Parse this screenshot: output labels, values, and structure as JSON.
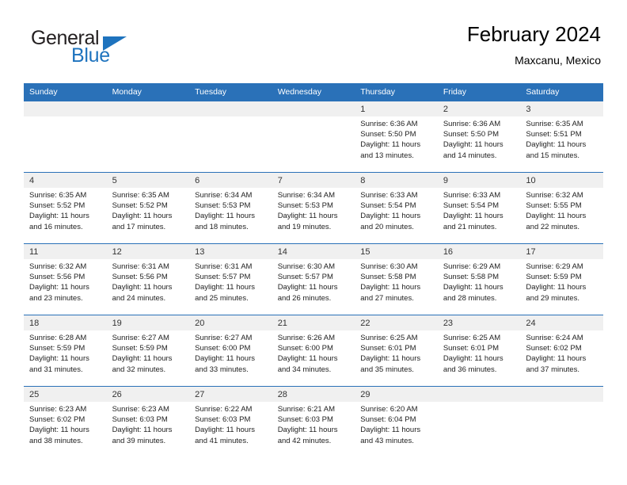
{
  "brand": {
    "name_part1": "General",
    "name_part2": "Blue",
    "logo_icon": "triangle-icon"
  },
  "header": {
    "title": "February 2024",
    "subtitle": "Maxcanu, Mexico"
  },
  "colors": {
    "header_blue": "#2a71b8",
    "daynum_band": "#f0f0f0",
    "brand_blue": "#1e73be"
  },
  "weekday_headers": [
    "Sunday",
    "Monday",
    "Tuesday",
    "Wednesday",
    "Thursday",
    "Friday",
    "Saturday"
  ],
  "weeks": [
    [
      {
        "day": "",
        "sunrise": "",
        "sunset": "",
        "daylight_line1": "",
        "daylight_line2": "",
        "empty": true
      },
      {
        "day": "",
        "sunrise": "",
        "sunset": "",
        "daylight_line1": "",
        "daylight_line2": "",
        "empty": true
      },
      {
        "day": "",
        "sunrise": "",
        "sunset": "",
        "daylight_line1": "",
        "daylight_line2": "",
        "empty": true
      },
      {
        "day": "",
        "sunrise": "",
        "sunset": "",
        "daylight_line1": "",
        "daylight_line2": "",
        "empty": true
      },
      {
        "day": "1",
        "sunrise": "Sunrise: 6:36 AM",
        "sunset": "Sunset: 5:50 PM",
        "daylight_line1": "Daylight: 11 hours",
        "daylight_line2": "and 13 minutes.",
        "empty": false
      },
      {
        "day": "2",
        "sunrise": "Sunrise: 6:36 AM",
        "sunset": "Sunset: 5:50 PM",
        "daylight_line1": "Daylight: 11 hours",
        "daylight_line2": "and 14 minutes.",
        "empty": false
      },
      {
        "day": "3",
        "sunrise": "Sunrise: 6:35 AM",
        "sunset": "Sunset: 5:51 PM",
        "daylight_line1": "Daylight: 11 hours",
        "daylight_line2": "and 15 minutes.",
        "empty": false
      }
    ],
    [
      {
        "day": "4",
        "sunrise": "Sunrise: 6:35 AM",
        "sunset": "Sunset: 5:52 PM",
        "daylight_line1": "Daylight: 11 hours",
        "daylight_line2": "and 16 minutes.",
        "empty": false
      },
      {
        "day": "5",
        "sunrise": "Sunrise: 6:35 AM",
        "sunset": "Sunset: 5:52 PM",
        "daylight_line1": "Daylight: 11 hours",
        "daylight_line2": "and 17 minutes.",
        "empty": false
      },
      {
        "day": "6",
        "sunrise": "Sunrise: 6:34 AM",
        "sunset": "Sunset: 5:53 PM",
        "daylight_line1": "Daylight: 11 hours",
        "daylight_line2": "and 18 minutes.",
        "empty": false
      },
      {
        "day": "7",
        "sunrise": "Sunrise: 6:34 AM",
        "sunset": "Sunset: 5:53 PM",
        "daylight_line1": "Daylight: 11 hours",
        "daylight_line2": "and 19 minutes.",
        "empty": false
      },
      {
        "day": "8",
        "sunrise": "Sunrise: 6:33 AM",
        "sunset": "Sunset: 5:54 PM",
        "daylight_line1": "Daylight: 11 hours",
        "daylight_line2": "and 20 minutes.",
        "empty": false
      },
      {
        "day": "9",
        "sunrise": "Sunrise: 6:33 AM",
        "sunset": "Sunset: 5:54 PM",
        "daylight_line1": "Daylight: 11 hours",
        "daylight_line2": "and 21 minutes.",
        "empty": false
      },
      {
        "day": "10",
        "sunrise": "Sunrise: 6:32 AM",
        "sunset": "Sunset: 5:55 PM",
        "daylight_line1": "Daylight: 11 hours",
        "daylight_line2": "and 22 minutes.",
        "empty": false
      }
    ],
    [
      {
        "day": "11",
        "sunrise": "Sunrise: 6:32 AM",
        "sunset": "Sunset: 5:56 PM",
        "daylight_line1": "Daylight: 11 hours",
        "daylight_line2": "and 23 minutes.",
        "empty": false
      },
      {
        "day": "12",
        "sunrise": "Sunrise: 6:31 AM",
        "sunset": "Sunset: 5:56 PM",
        "daylight_line1": "Daylight: 11 hours",
        "daylight_line2": "and 24 minutes.",
        "empty": false
      },
      {
        "day": "13",
        "sunrise": "Sunrise: 6:31 AM",
        "sunset": "Sunset: 5:57 PM",
        "daylight_line1": "Daylight: 11 hours",
        "daylight_line2": "and 25 minutes.",
        "empty": false
      },
      {
        "day": "14",
        "sunrise": "Sunrise: 6:30 AM",
        "sunset": "Sunset: 5:57 PM",
        "daylight_line1": "Daylight: 11 hours",
        "daylight_line2": "and 26 minutes.",
        "empty": false
      },
      {
        "day": "15",
        "sunrise": "Sunrise: 6:30 AM",
        "sunset": "Sunset: 5:58 PM",
        "daylight_line1": "Daylight: 11 hours",
        "daylight_line2": "and 27 minutes.",
        "empty": false
      },
      {
        "day": "16",
        "sunrise": "Sunrise: 6:29 AM",
        "sunset": "Sunset: 5:58 PM",
        "daylight_line1": "Daylight: 11 hours",
        "daylight_line2": "and 28 minutes.",
        "empty": false
      },
      {
        "day": "17",
        "sunrise": "Sunrise: 6:29 AM",
        "sunset": "Sunset: 5:59 PM",
        "daylight_line1": "Daylight: 11 hours",
        "daylight_line2": "and 29 minutes.",
        "empty": false
      }
    ],
    [
      {
        "day": "18",
        "sunrise": "Sunrise: 6:28 AM",
        "sunset": "Sunset: 5:59 PM",
        "daylight_line1": "Daylight: 11 hours",
        "daylight_line2": "and 31 minutes.",
        "empty": false
      },
      {
        "day": "19",
        "sunrise": "Sunrise: 6:27 AM",
        "sunset": "Sunset: 5:59 PM",
        "daylight_line1": "Daylight: 11 hours",
        "daylight_line2": "and 32 minutes.",
        "empty": false
      },
      {
        "day": "20",
        "sunrise": "Sunrise: 6:27 AM",
        "sunset": "Sunset: 6:00 PM",
        "daylight_line1": "Daylight: 11 hours",
        "daylight_line2": "and 33 minutes.",
        "empty": false
      },
      {
        "day": "21",
        "sunrise": "Sunrise: 6:26 AM",
        "sunset": "Sunset: 6:00 PM",
        "daylight_line1": "Daylight: 11 hours",
        "daylight_line2": "and 34 minutes.",
        "empty": false
      },
      {
        "day": "22",
        "sunrise": "Sunrise: 6:25 AM",
        "sunset": "Sunset: 6:01 PM",
        "daylight_line1": "Daylight: 11 hours",
        "daylight_line2": "and 35 minutes.",
        "empty": false
      },
      {
        "day": "23",
        "sunrise": "Sunrise: 6:25 AM",
        "sunset": "Sunset: 6:01 PM",
        "daylight_line1": "Daylight: 11 hours",
        "daylight_line2": "and 36 minutes.",
        "empty": false
      },
      {
        "day": "24",
        "sunrise": "Sunrise: 6:24 AM",
        "sunset": "Sunset: 6:02 PM",
        "daylight_line1": "Daylight: 11 hours",
        "daylight_line2": "and 37 minutes.",
        "empty": false
      }
    ],
    [
      {
        "day": "25",
        "sunrise": "Sunrise: 6:23 AM",
        "sunset": "Sunset: 6:02 PM",
        "daylight_line1": "Daylight: 11 hours",
        "daylight_line2": "and 38 minutes.",
        "empty": false
      },
      {
        "day": "26",
        "sunrise": "Sunrise: 6:23 AM",
        "sunset": "Sunset: 6:03 PM",
        "daylight_line1": "Daylight: 11 hours",
        "daylight_line2": "and 39 minutes.",
        "empty": false
      },
      {
        "day": "27",
        "sunrise": "Sunrise: 6:22 AM",
        "sunset": "Sunset: 6:03 PM",
        "daylight_line1": "Daylight: 11 hours",
        "daylight_line2": "and 41 minutes.",
        "empty": false
      },
      {
        "day": "28",
        "sunrise": "Sunrise: 6:21 AM",
        "sunset": "Sunset: 6:03 PM",
        "daylight_line1": "Daylight: 11 hours",
        "daylight_line2": "and 42 minutes.",
        "empty": false
      },
      {
        "day": "29",
        "sunrise": "Sunrise: 6:20 AM",
        "sunset": "Sunset: 6:04 PM",
        "daylight_line1": "Daylight: 11 hours",
        "daylight_line2": "and 43 minutes.",
        "empty": false
      },
      {
        "day": "",
        "sunrise": "",
        "sunset": "",
        "daylight_line1": "",
        "daylight_line2": "",
        "empty": true
      },
      {
        "day": "",
        "sunrise": "",
        "sunset": "",
        "daylight_line1": "",
        "daylight_line2": "",
        "empty": true
      }
    ]
  ]
}
